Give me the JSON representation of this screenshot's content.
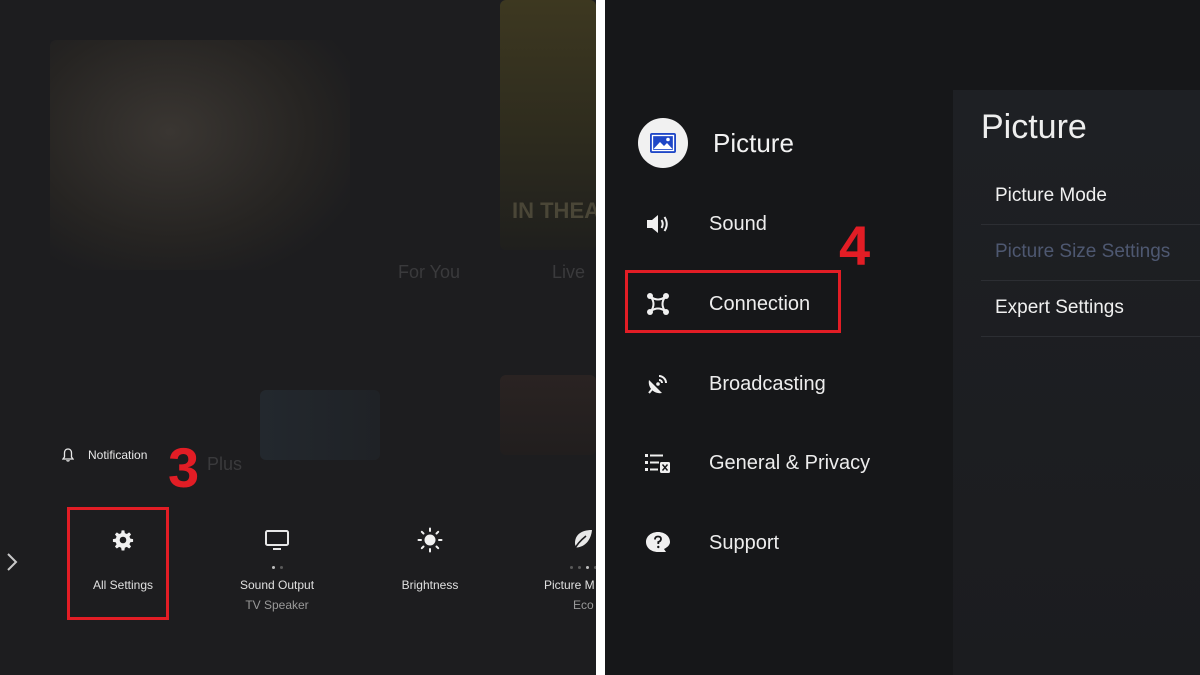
{
  "left_panel": {
    "background_text": {
      "in_theaters": "IN THEAT",
      "for_you": "For You",
      "live": "Live",
      "plus": "Plus"
    },
    "notification": {
      "icon": "bell-icon",
      "label": "Notification"
    },
    "quick_settings": [
      {
        "icon": "gear-icon",
        "label": "All Settings",
        "sub": ""
      },
      {
        "icon": "monitor-icon",
        "label": "Sound Output",
        "sub": "TV Speaker"
      },
      {
        "icon": "sun-icon",
        "label": "Brightness",
        "sub": ""
      },
      {
        "icon": "leaf-icon",
        "label": "Picture M",
        "sub": "Eco"
      }
    ],
    "step_number": "3",
    "highlight_color": "#e21d25"
  },
  "right_panel": {
    "menu": [
      {
        "icon": "picture-icon",
        "label": "Picture",
        "selected": true
      },
      {
        "icon": "speaker-icon",
        "label": "Sound"
      },
      {
        "icon": "connection-icon",
        "label": "Connection"
      },
      {
        "icon": "satellite-icon",
        "label": "Broadcasting"
      },
      {
        "icon": "privacy-list-icon",
        "label": "General & Privacy"
      },
      {
        "icon": "support-icon",
        "label": "Support"
      }
    ],
    "submenu": {
      "title": "Picture",
      "items": [
        {
          "label": "Picture Mode",
          "enabled": true
        },
        {
          "label": "Picture Size Settings",
          "enabled": false
        },
        {
          "label": "Expert Settings",
          "enabled": true
        }
      ]
    },
    "step_number": "4"
  }
}
